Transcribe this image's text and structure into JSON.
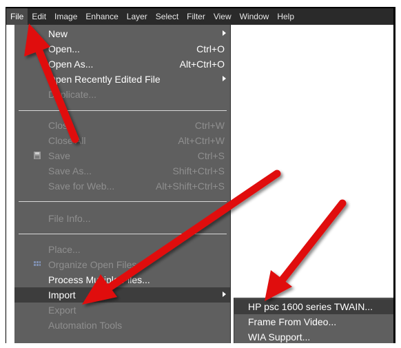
{
  "menubar": {
    "items": [
      "File",
      "Edit",
      "Image",
      "Enhance",
      "Layer",
      "Select",
      "Filter",
      "View",
      "Window",
      "Help"
    ]
  },
  "file_menu": {
    "new": {
      "label": "New"
    },
    "open": {
      "label": "Open...",
      "shortcut": "Ctrl+O"
    },
    "open_as": {
      "label": "Open As...",
      "shortcut": "Alt+Ctrl+O"
    },
    "open_recent": {
      "label": "Open Recently Edited File"
    },
    "duplicate": {
      "label": "Duplicate..."
    },
    "close": {
      "label": "Close",
      "shortcut": "Ctrl+W"
    },
    "close_all": {
      "label": "Close All",
      "shortcut": "Alt+Ctrl+W"
    },
    "save": {
      "label": "Save",
      "shortcut": "Ctrl+S"
    },
    "save_as": {
      "label": "Save As...",
      "shortcut": "Shift+Ctrl+S"
    },
    "save_for_web": {
      "label": "Save for Web...",
      "shortcut": "Alt+Shift+Ctrl+S"
    },
    "file_info": {
      "label": "File Info..."
    },
    "place": {
      "label": "Place..."
    },
    "organize_open_files": {
      "label": "Organize Open Files..."
    },
    "process_multiple_files": {
      "label": "Process Multiple Files..."
    },
    "import": {
      "label": "Import"
    },
    "export": {
      "label": "Export"
    },
    "automation_tools": {
      "label": "Automation Tools"
    }
  },
  "import_submenu": {
    "items": [
      "HP psc 1600 series TWAIN...",
      "Frame From Video...",
      "WIA Support..."
    ]
  },
  "colors": {
    "menubar_bg": "#2a2a2a",
    "menu_bg": "#5f5f5f",
    "highlight_bg": "#3d3d3d",
    "disabled_text": "#8f8f8f",
    "annotation_arrow": "#e01010"
  }
}
